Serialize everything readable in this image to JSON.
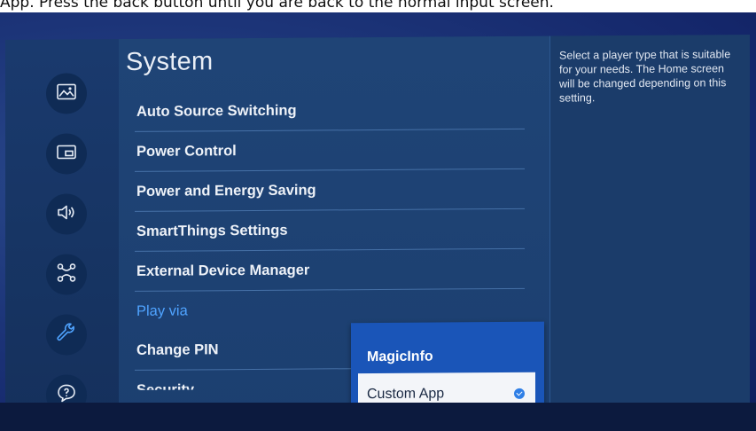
{
  "caption": {
    "text": "App. Press the back button until you are back to the normal input screen."
  },
  "sidebar": {
    "icons": [
      {
        "name": "picture-icon"
      },
      {
        "name": "screen-icon"
      },
      {
        "name": "sound-icon"
      },
      {
        "name": "connection-icon"
      },
      {
        "name": "wrench-icon",
        "active": true
      },
      {
        "name": "support-icon"
      }
    ]
  },
  "page": {
    "title": "System",
    "items": [
      {
        "label": "Auto Source Switching"
      },
      {
        "label": "Power Control"
      },
      {
        "label": "Power and Energy Saving"
      },
      {
        "label": "SmartThings Settings"
      },
      {
        "label": "External Device Manager"
      },
      {
        "label": "Play via",
        "active": true
      },
      {
        "label": "Change PIN"
      },
      {
        "label": "Security"
      }
    ]
  },
  "help": {
    "text": "Select a player type that is suitable for your needs. The Home screen will be changed depending on this setting."
  },
  "popup": {
    "options": [
      {
        "label": "MagicInfo"
      },
      {
        "label": "Custom App",
        "selected": true
      }
    ]
  },
  "colors": {
    "accent": "#4fa3ff",
    "popup_bg": "#1a55b8",
    "selected_bg": "#f3f5f9"
  }
}
